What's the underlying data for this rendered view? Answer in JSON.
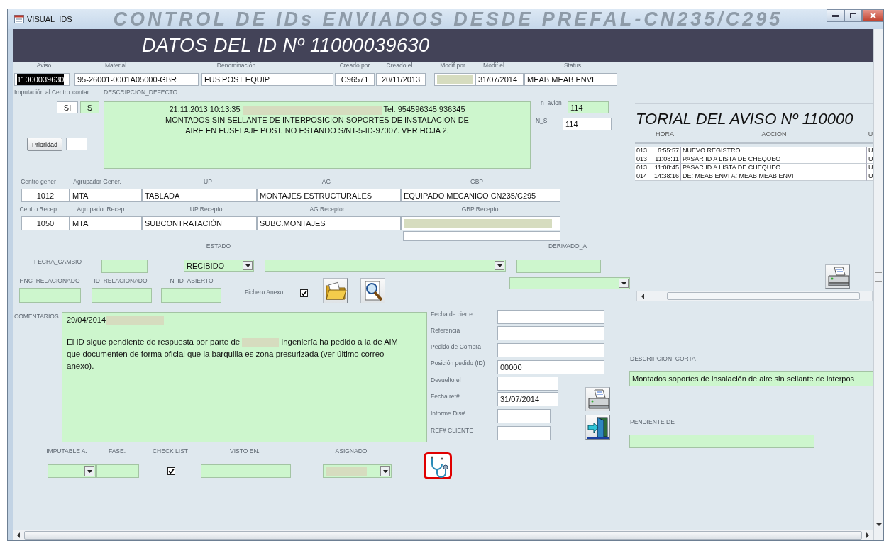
{
  "window": {
    "title": "VISUAL_IDS",
    "background_title": "CONTROL DE IDs ENVIADOS DESDE PREFAL-CN235/C295"
  },
  "header": "DATOS DEL ID Nº  11000039630",
  "record": [
    {
      "label": "Aviso",
      "kind": "text",
      "value": "11000039630",
      "selected": true
    },
    {
      "label": "Material",
      "kind": "text",
      "value": "95-26001-0001A05000-GBR",
      "selected": false
    },
    {
      "label": "Denominación",
      "kind": "text",
      "value": "FUS POST EQUIP",
      "selected": false
    },
    {
      "label": "Creado por",
      "kind": "text",
      "value": "C96571",
      "selected": false
    },
    {
      "label": "Creado el",
      "kind": "text",
      "value": "20/11/2013",
      "selected": false
    },
    {
      "label": "Modif por",
      "kind": "redacted",
      "selected": false
    },
    {
      "label": "Modif el",
      "kind": "text",
      "value": "31/07/2014",
      "selected": false
    },
    {
      "label": "Status",
      "kind": "text",
      "value": "MEAB MEAB ENVI",
      "selected": false
    }
  ],
  "controls": [
    {
      "kind": "text",
      "label": "Imputación al Centro",
      "value": "SI"
    },
    {
      "kind": "text",
      "label": "contar",
      "value": "S"
    },
    {
      "kind": "note",
      "label": "DESCRIPCION_DEFECTO",
      "stamp": "21.11.2013 10:13:35",
      "phone": "Tel. 954596345 936345",
      "text": "MONTADOS SIN SELLANTE DE INTERPOSICION SOPORTES DE INSTALACION DE AIRE EN FUSELAJE POST. NO ESTANDO S/NT-5-ID-97007. VER HOJA 2."
    },
    {
      "kind": "text",
      "label": "n_avion",
      "value": "114"
    },
    {
      "kind": "text",
      "label": "N_S",
      "value": "114"
    },
    {
      "kind": "button",
      "label": "Prioridad"
    },
    {
      "kind": "text"
    },
    {
      "kind": "text",
      "label": "Centro gener",
      "value": "1012"
    },
    {
      "kind": "text",
      "label": "Agrupador Gener.",
      "value": "MTA"
    },
    {
      "kind": "text",
      "label": "UP",
      "value": "TABLADA"
    },
    {
      "kind": "text",
      "label": "AG",
      "value": "MONTAJES ESTRUCTURALES"
    },
    {
      "kind": "text",
      "label": "GBP",
      "value": "EQUIPADO MECANICO CN235/C295"
    },
    {
      "kind": "text",
      "label": "Centro Recep.",
      "value": "1050"
    },
    {
      "kind": "text",
      "label": "Agrupador Recep.",
      "value": "MTA"
    },
    {
      "kind": "text",
      "label": "UP Receptor",
      "value": "SUBCONTRATACIÓN"
    },
    {
      "kind": "text",
      "label": "AG Receptor",
      "value": "SUBC.MONTAJES"
    },
    {
      "kind": "redacted",
      "label": "GBP Receptor"
    },
    {
      "kind": "text"
    },
    {
      "kind": "text",
      "label": "FECHA_CAMBIO"
    },
    {
      "kind": "combo",
      "label": "ESTADO",
      "value": "RECIBIDO"
    },
    {
      "kind": "combo"
    },
    {
      "kind": "text",
      "label": "DERIVADO_A"
    },
    {
      "kind": "text",
      "label": "HNC_RELACIONADO"
    },
    {
      "kind": "text",
      "label": "ID_RELACIONADO"
    },
    {
      "kind": "text",
      "label": "N_ID_ABIERTO"
    },
    {
      "kind": "check",
      "label": "Fichero Anexo",
      "checked": true
    },
    {
      "kind": "icon_button"
    },
    {
      "kind": "icon_button"
    },
    {
      "kind": "combo"
    },
    {
      "kind": "comments",
      "label": "COMENTARIOS",
      "stamp": "29/04/2014",
      "text_before": "El ID sigue pendiente de respuesta por parte de",
      "text_after": "ingeniería ha pedido a la de AiM que documenten de forma oficial que la barquilla es zona presurizada (ver último correo anexo)."
    },
    {
      "kind": "text",
      "label": "Fecha de cierre"
    },
    {
      "kind": "text",
      "label": "Referencia"
    },
    {
      "kind": "text",
      "label": "Pedido de Compra"
    },
    {
      "kind": "text",
      "label": "Posición pedido (ID)",
      "value": "00000"
    },
    {
      "kind": "text",
      "label": "Devuelto el"
    },
    {
      "kind": "text",
      "label": "Fecha ref#",
      "value": "31/07/2014"
    },
    {
      "kind": "text",
      "label": "Informe Dis#"
    },
    {
      "kind": "text",
      "label": "REF# CLIENTE"
    },
    {
      "kind": "icon_button"
    },
    {
      "kind": "icon_button"
    },
    {
      "kind": "text",
      "label": "DESCRIPCION_CORTA",
      "value": "Montados soportes de insalación de aire sin sellante de interpos"
    },
    {
      "kind": "text",
      "label": "PENDIENTE DE"
    },
    {
      "kind": "combo",
      "label": "IMPUTABLE A:"
    },
    {
      "kind": "text",
      "label": "FASE:"
    },
    {
      "kind": "check",
      "label": "CHECK LIST",
      "checked": true
    },
    {
      "kind": "text",
      "label": "VISTO EN:"
    },
    {
      "kind": "redacted_combo",
      "label": "ASIGNADO"
    },
    {
      "kind": "icon_button"
    }
  ],
  "history": {
    "title": "TORIAL DEL AVISO Nº  110000",
    "columns": [
      "HORA",
      "ACCION",
      "U"
    ],
    "rows": [
      {
        "date": "013",
        "time": "6:55:57",
        "action": "NUEVO REGISTRO",
        "user": "U"
      },
      {
        "date": "013",
        "time": "11:08:11",
        "action": "PASAR ID A LISTA DE CHEQUEO",
        "user": "U"
      },
      {
        "date": "013",
        "time": "11:08:45",
        "action": "PASAR ID A LISTA DE CHEQUEO",
        "user": "U"
      },
      {
        "date": "014",
        "time": "14:38:16",
        "action": "DE: MEAB ENVI A: MEAB MEAB ENVI",
        "user": "U"
      }
    ]
  }
}
